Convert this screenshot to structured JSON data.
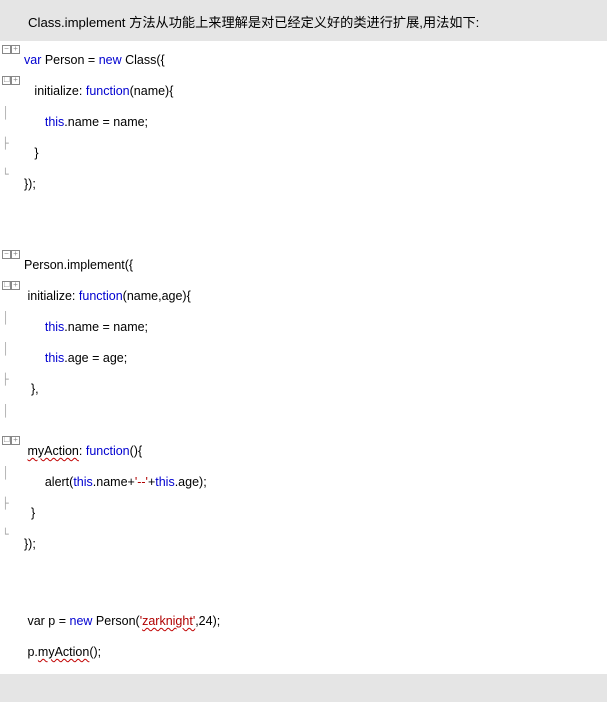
{
  "heading": "Class.implement 方法从功能上来理解是对已经定义好的类进行扩展,用法如下:",
  "code": {
    "l1_pre": "var",
    "l1_mid": " Person = ",
    "l1_new": "new",
    "l1_post": " Class({",
    "l2_pre": "   initialize: ",
    "l2_fn": "function",
    "l2_post": "(name){",
    "l3_pre": "      ",
    "l3_this": "this",
    "l3_post": ".name = name;",
    "l4": "   }",
    "l5": "});",
    "l6": "Person.implement({",
    "l7_pre": " initialize: ",
    "l7_fn": "function",
    "l7_post": "(name,age){",
    "l8_pre": "      ",
    "l8_this": "this",
    "l8_post": ".name = name;",
    "l9_pre": "      ",
    "l9_this": "this",
    "l9_post": ".age = age;",
    "l10": "  },",
    "l11": "",
    "l12_pre": " ",
    "l12_my": "myAction",
    "l12_mid": ": ",
    "l12_fn": "function",
    "l12_post": "(){",
    "l13_pre": "      alert(",
    "l13_this1": "this",
    "l13_mid1": ".name+",
    "l13_str": "'--'",
    "l13_mid2": "+",
    "l13_this2": "this",
    "l13_post": ".age);",
    "l14": "  }",
    "l15": "});",
    "l16_pre": " var p = ",
    "l16_new": "new",
    "l16_post1": " Person(",
    "l16_str": "'",
    "l16_zark": "zarknight'",
    "l16_post2": ",24);",
    "l17_pre": " p.",
    "l17_my": "myAction",
    "l17_post": "();"
  }
}
